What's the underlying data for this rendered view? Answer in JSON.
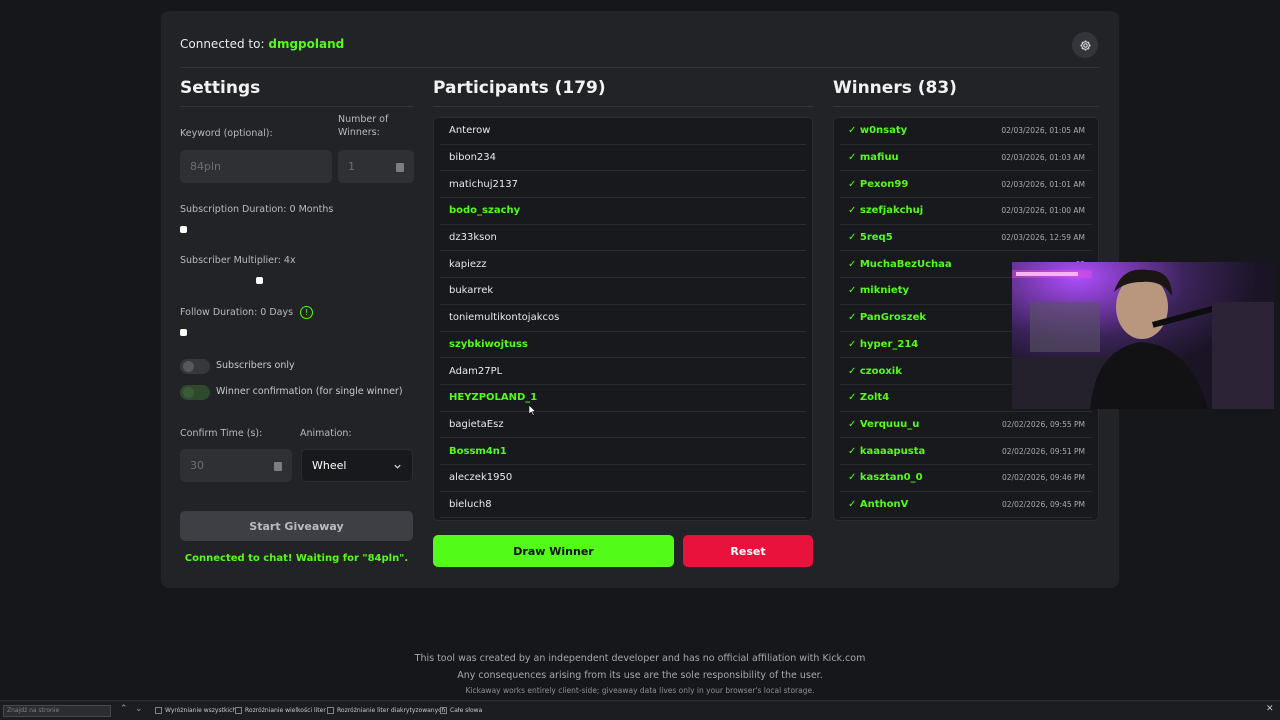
{
  "header": {
    "connected_prefix": "Connected to:",
    "channel": "dmgpoland"
  },
  "settings": {
    "title": "Settings",
    "keyword_label": "Keyword (optional):",
    "keyword_value": "84pln",
    "winners_label": "Number of Winners:",
    "winners_value": "1",
    "sub_duration_label": "Subscription Duration: 0 Months",
    "sub_duration_level": 0,
    "sub_multiplier_label": "Subscriber Multiplier: 4x",
    "sub_multiplier_level": 0.33,
    "follow_duration_label": "Follow Duration: 0 Days",
    "follow_duration_level": 0,
    "subscribers_only_label": "Subscribers only",
    "winner_confirmation_label": "Winner confirmation (for single winner)",
    "confirm_time_label": "Confirm Time (s):",
    "confirm_time_value": "30",
    "animation_label": "Animation:",
    "animation_value": "Wheel",
    "start_label": "Start Giveaway",
    "status": "Connected to chat! Waiting for \"84pln\"."
  },
  "participants": {
    "title": "Participants (179)",
    "items": [
      {
        "name": "Anterow",
        "sub": false
      },
      {
        "name": "bibon234",
        "sub": false
      },
      {
        "name": "matichuj2137",
        "sub": false
      },
      {
        "name": "bodo_szachy",
        "sub": true
      },
      {
        "name": "dz33kson",
        "sub": false
      },
      {
        "name": "kapiezz",
        "sub": false
      },
      {
        "name": "bukarrek",
        "sub": false
      },
      {
        "name": "toniemultikontojakcos",
        "sub": false
      },
      {
        "name": "szybkiwojtuss",
        "sub": true
      },
      {
        "name": "Adam27PL",
        "sub": false
      },
      {
        "name": "HEYZPOLAND_1",
        "sub": true
      },
      {
        "name": "bagietaEsz",
        "sub": false
      },
      {
        "name": "Bossm4n1",
        "sub": true
      },
      {
        "name": "aleczek1950",
        "sub": false
      },
      {
        "name": "bieluch8",
        "sub": false
      }
    ],
    "draw_label": "Draw Winner",
    "reset_label": "Reset"
  },
  "winners": {
    "title": "Winners (83)",
    "items": [
      {
        "name": "✓ w0nsaty",
        "date": "02/03/2026, 01:05 AM"
      },
      {
        "name": "✓ mafiuu",
        "date": "02/03/2026, 01:03 AM"
      },
      {
        "name": "✓ Pexon99",
        "date": "02/03/2026, 01:01 AM"
      },
      {
        "name": "✓ szefjakchuj",
        "date": "02/03/2026, 01:00 AM"
      },
      {
        "name": "✓ 5req5",
        "date": "02/03/2026, 12:59 AM"
      },
      {
        "name": "✓ MuchaBezUchaa",
        "date": "02"
      },
      {
        "name": "✓ mikniety",
        "date": "0"
      },
      {
        "name": "✓ PanGroszek",
        "date": "0"
      },
      {
        "name": "✓ hyper_214",
        "date": "0"
      },
      {
        "name": "✓ czooxik",
        "date": "0"
      },
      {
        "name": "✓ Zolt4",
        "date": "02"
      },
      {
        "name": "✓ Verquuu_u",
        "date": "02/02/2026, 09:55 PM"
      },
      {
        "name": "✓ kaaaapusta",
        "date": "02/02/2026, 09:51 PM"
      },
      {
        "name": "✓ kasztan0_0",
        "date": "02/02/2026, 09:46 PM"
      },
      {
        "name": "✓ AnthonV",
        "date": "02/02/2026, 09:45 PM"
      }
    ]
  },
  "footer": {
    "line1": "This tool was created by an independent developer and has no official affiliation with Kick.com",
    "line2": "Any consequences arising from its use are the sole responsibility of the user.",
    "line3": "Kickaway works entirely client-side; giveaway data lives only in your browser's local storage."
  },
  "findbar": {
    "placeholder": "Znajdź na stronie",
    "opt1": "Wyróżnianie wszystkich",
    "opt2": "Rozróżnianie wielkości liter",
    "opt3": "Rozróżnianie liter diakrytyzowanych",
    "opt4": "Całe słowa"
  },
  "colors": {
    "accent": "#53fc18",
    "danger": "#e8123d",
    "background": "#16171a",
    "card": "#222326"
  }
}
